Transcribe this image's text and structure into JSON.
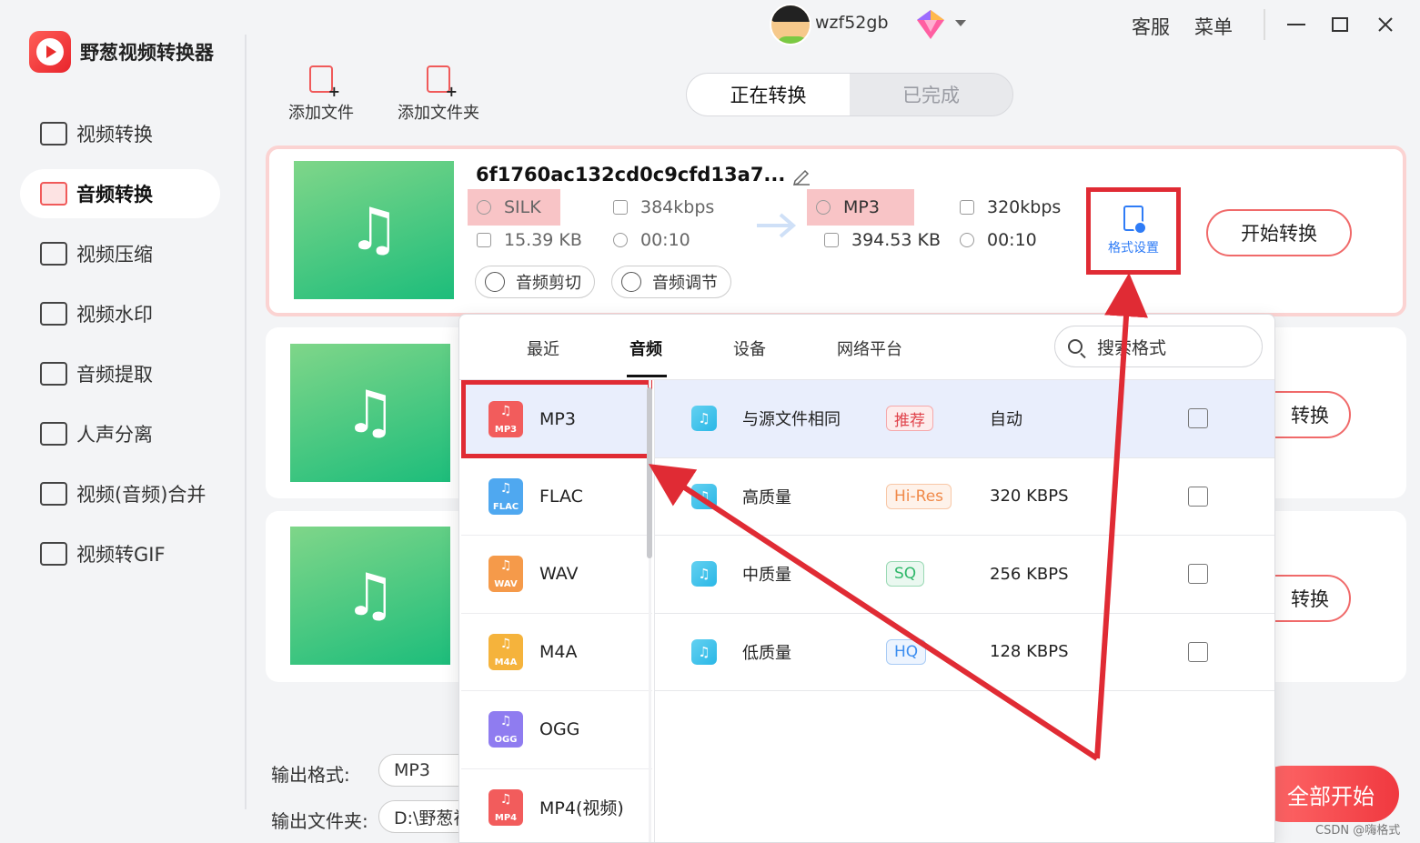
{
  "app": {
    "name": "野葱视频转换器",
    "brand_color": "#e8242c",
    "accent_color": "#2f7cf6",
    "annotation_color": "#e02b34"
  },
  "sidebar": {
    "items": [
      {
        "label": "视频转换",
        "icon": "video-convert-icon",
        "active": false
      },
      {
        "label": "音频转换",
        "icon": "audio-convert-icon",
        "active": true
      },
      {
        "label": "视频压缩",
        "icon": "video-compress-icon",
        "active": false
      },
      {
        "label": "视频水印",
        "icon": "video-watermark-icon",
        "active": false
      },
      {
        "label": "音频提取",
        "icon": "audio-extract-icon",
        "active": false
      },
      {
        "label": "人声分离",
        "icon": "vocal-separate-icon",
        "active": false
      },
      {
        "label": "视频(音频)合并",
        "icon": "merge-icon",
        "active": false
      },
      {
        "label": "视频转GIF",
        "icon": "gif-icon",
        "active": false
      }
    ]
  },
  "topbar": {
    "username": "wzf52gb",
    "service": "客服",
    "menu": "菜单"
  },
  "toolbar": {
    "add_file": "添加文件",
    "add_folder": "添加文件夹"
  },
  "tabs": {
    "converting": "正在转换",
    "done": "已完成"
  },
  "file": {
    "name": "6f1760ac132cd0c9cfd13a7...",
    "src_format": "SILK",
    "src_bitrate": "384kbps",
    "src_size": "15.39 KB",
    "src_duration": "00:10",
    "dst_format": "MP3",
    "dst_bitrate": "320kbps",
    "dst_size": "394.53 KB",
    "dst_duration": "00:10",
    "audio_cut": "音频剪切",
    "audio_adjust": "音频调节",
    "format_settings": "格式设置",
    "start_convert": "开始转换",
    "start_convert_partial": "转换"
  },
  "bottom": {
    "output_format_label": "输出格式:",
    "output_format_value": "MP3",
    "output_folder_label": "输出文件夹:",
    "output_folder_value": "D:\\野葱视",
    "start_all": "全部开始"
  },
  "dropdown": {
    "tabs": [
      "最近",
      "音频",
      "设备",
      "网络平台"
    ],
    "active_tab": "音频",
    "search_placeholder": "搜索格式",
    "formats": [
      {
        "label": "MP3",
        "tag": "MP3",
        "color": "#f25c5c",
        "selected": true
      },
      {
        "label": "FLAC",
        "tag": "FLAC",
        "color": "#4fa8f0",
        "selected": false
      },
      {
        "label": "WAV",
        "tag": "WAV",
        "color": "#f59a4a",
        "selected": false
      },
      {
        "label": "M4A",
        "tag": "M4A",
        "color": "#f5b33c",
        "selected": false
      },
      {
        "label": "OGG",
        "tag": "OGG",
        "color": "#8f7cf0",
        "selected": false
      },
      {
        "label": "MP4(视频)",
        "tag": "MP4",
        "color": "#f25c5c",
        "selected": false
      }
    ],
    "qualities": [
      {
        "name": "与源文件相同",
        "badge": "推荐",
        "badge_color": "#e0424a",
        "value": "自动"
      },
      {
        "name": "高质量",
        "badge": "Hi-Res",
        "badge_color": "#f08a4a",
        "value": "320 KBPS"
      },
      {
        "name": "中质量",
        "badge": "SQ",
        "badge_color": "#2fb86a",
        "value": "256 KBPS"
      },
      {
        "name": "低质量",
        "badge": "HQ",
        "badge_color": "#3d8ef0",
        "value": "128 KBPS"
      }
    ]
  },
  "watermark": "CSDN @嗨格式"
}
